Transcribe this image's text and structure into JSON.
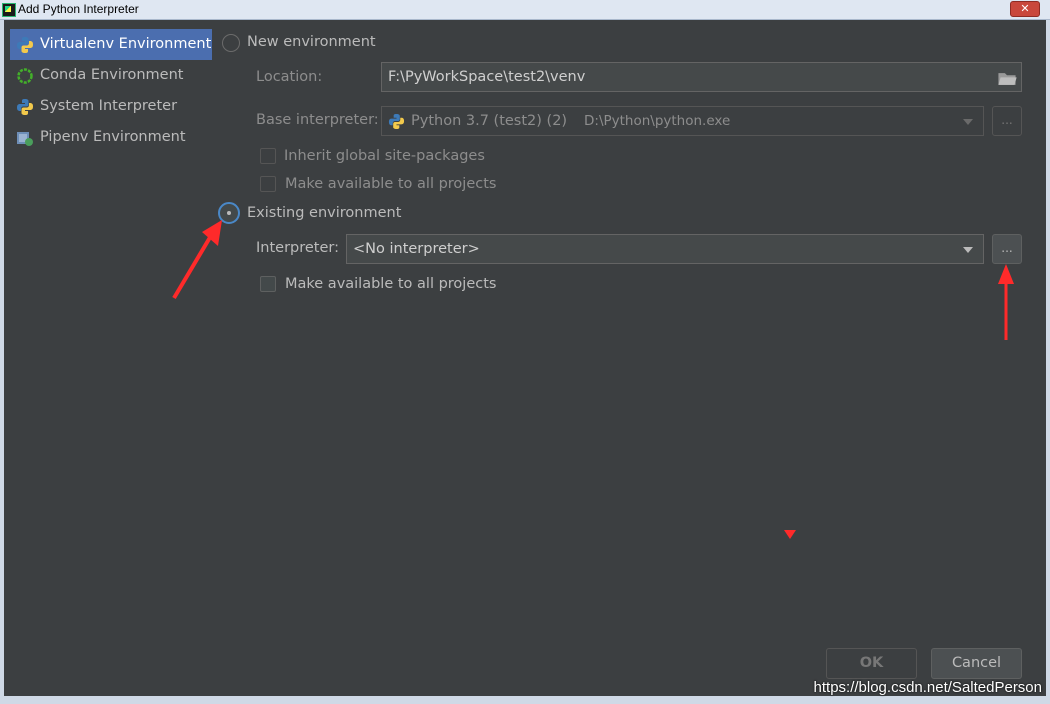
{
  "window": {
    "title": "Add Python Interpreter",
    "close_glyph": "✕"
  },
  "sidebar": {
    "items": [
      {
        "label": "Virtualenv Environment",
        "icon": "python-icon",
        "selected": true
      },
      {
        "label": "Conda Environment",
        "icon": "conda-icon",
        "selected": false
      },
      {
        "label": "System Interpreter",
        "icon": "python-icon",
        "selected": false
      },
      {
        "label": "Pipenv Environment",
        "icon": "pipenv-icon",
        "selected": false
      }
    ]
  },
  "new_env": {
    "radio_label": "New environment",
    "location_label": "Location:",
    "location_value": "F:\\PyWorkSpace\\test2\\venv",
    "base_interpreter_label": "Base interpreter:",
    "base_interpreter_value": "Python 3.7 (test2) (2)",
    "base_interpreter_path": "D:\\Python\\python.exe",
    "inherit_label": "Inherit global site-packages",
    "make_available_label": "Make available to all projects",
    "browse_label": "..."
  },
  "existing_env": {
    "radio_label": "Existing environment",
    "interpreter_label": "Interpreter:",
    "interpreter_value": "<No interpreter>",
    "browse_label": "...",
    "make_available_label": "Make available to all projects"
  },
  "buttons": {
    "ok": "OK",
    "cancel": "Cancel"
  },
  "watermark": "https://blog.csdn.net/SaltedPerson",
  "colors": {
    "background": "#3c3f41",
    "selection": "#4b6eaf",
    "annotation": "#ff2a2a"
  }
}
